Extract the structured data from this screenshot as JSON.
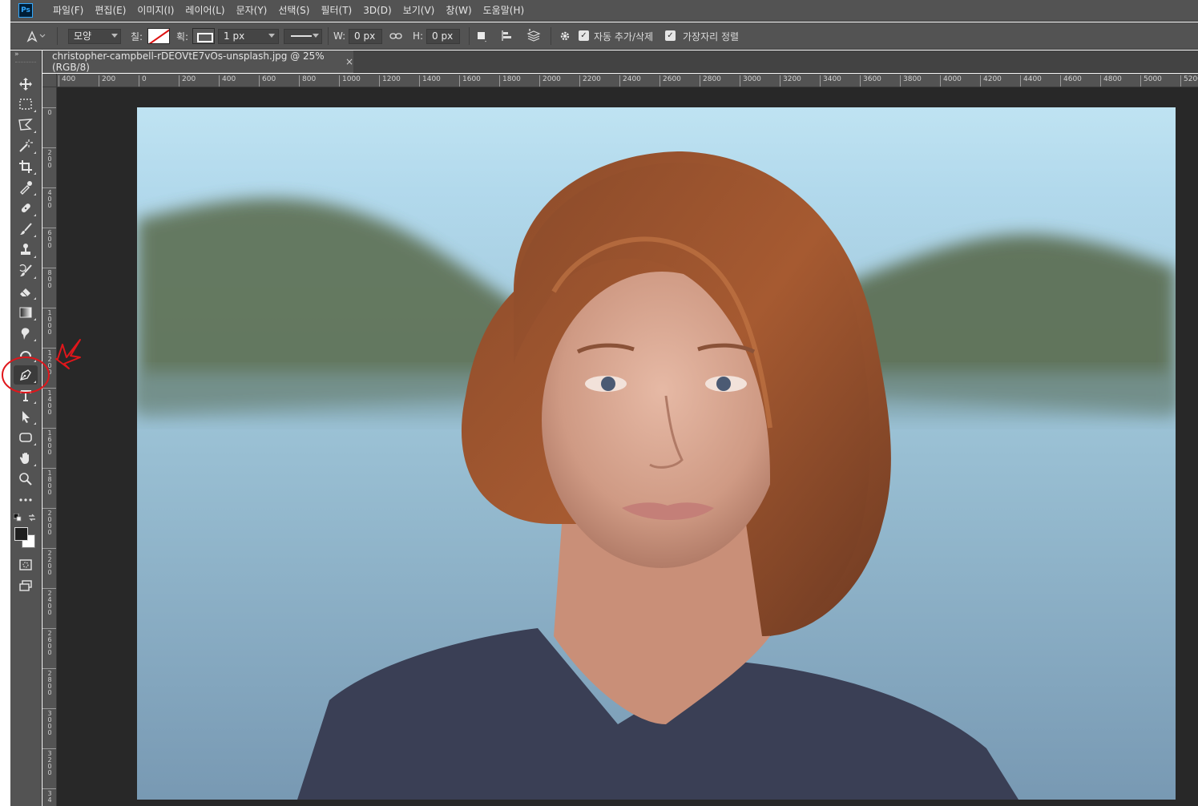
{
  "app": {
    "logo_text": "Ps",
    "menu": [
      "파일(F)",
      "편집(E)",
      "이미지(I)",
      "레이어(L)",
      "문자(Y)",
      "선택(S)",
      "필터(T)",
      "3D(D)",
      "보기(V)",
      "창(W)",
      "도움말(H)"
    ]
  },
  "options": {
    "tool_icon": "pen-tool-icon",
    "mode_value": "모양",
    "fill_label": "칠:",
    "stroke_label": "획:",
    "stroke_width_value": "1 px",
    "w_label": "W:",
    "w_value": "0 px",
    "h_label": "H:",
    "h_value": "0 px",
    "auto_add_delete_label": "자동 추가/삭제",
    "auto_add_delete_checked": true,
    "align_edges_label": "가장자리 정렬",
    "align_edges_checked": true
  },
  "document": {
    "tab_title": "christopher-campbell-rDEOVtE7vOs-unsplash.jpg @ 25% (RGB/8)",
    "close_glyph": "×"
  },
  "rulers": {
    "horizontal_labels": [
      "400",
      "200",
      "0",
      "200",
      "400",
      "600",
      "800",
      "1000",
      "1200",
      "1400",
      "1600",
      "1800",
      "2000",
      "2200",
      "2400",
      "2600",
      "2800",
      "3000",
      "3200",
      "3400",
      "3600",
      "3800",
      "4000",
      "4200",
      "4400",
      "4600",
      "4800",
      "5000",
      "5200"
    ],
    "vertical_labels": [
      "0",
      "200",
      "400",
      "600",
      "800",
      "1000",
      "1200",
      "1400",
      "1600",
      "1800",
      "2000",
      "2200",
      "2400",
      "2600",
      "2800",
      "3000",
      "3200",
      "34"
    ]
  },
  "tools": [
    {
      "name": "move-tool",
      "icon": "move-icon"
    },
    {
      "name": "marquee-tool",
      "icon": "rectangular-marquee-icon"
    },
    {
      "name": "lasso-tool",
      "icon": "polygonal-lasso-icon"
    },
    {
      "name": "magic-wand-tool",
      "icon": "magic-wand-icon"
    },
    {
      "name": "crop-tool",
      "icon": "crop-icon"
    },
    {
      "name": "eyedropper-tool",
      "icon": "eyedropper-icon"
    },
    {
      "name": "healing-brush-tool",
      "icon": "bandage-icon"
    },
    {
      "name": "brush-tool",
      "icon": "brush-icon"
    },
    {
      "name": "clone-stamp-tool",
      "icon": "stamp-icon"
    },
    {
      "name": "history-brush-tool",
      "icon": "history-brush-icon"
    },
    {
      "name": "eraser-tool",
      "icon": "eraser-icon"
    },
    {
      "name": "gradient-tool",
      "icon": "gradient-icon"
    },
    {
      "name": "smudge-tool",
      "icon": "smudge-icon"
    },
    {
      "name": "dodge-tool",
      "icon": "dodge-icon"
    },
    {
      "name": "pen-tool",
      "icon": "pen-icon",
      "active": true
    },
    {
      "name": "type-tool",
      "icon": "type-icon"
    },
    {
      "name": "path-selection-tool",
      "icon": "arrow-icon"
    },
    {
      "name": "shape-tool",
      "icon": "rounded-rectangle-icon"
    },
    {
      "name": "hand-tool",
      "icon": "hand-icon"
    },
    {
      "name": "zoom-tool",
      "icon": "zoom-icon"
    },
    {
      "name": "more-tools",
      "icon": "ellipsis-icon"
    }
  ],
  "colors": {
    "foreground": "#1e1e1e",
    "background": "#ffffff",
    "annotation": "#e0161b"
  }
}
